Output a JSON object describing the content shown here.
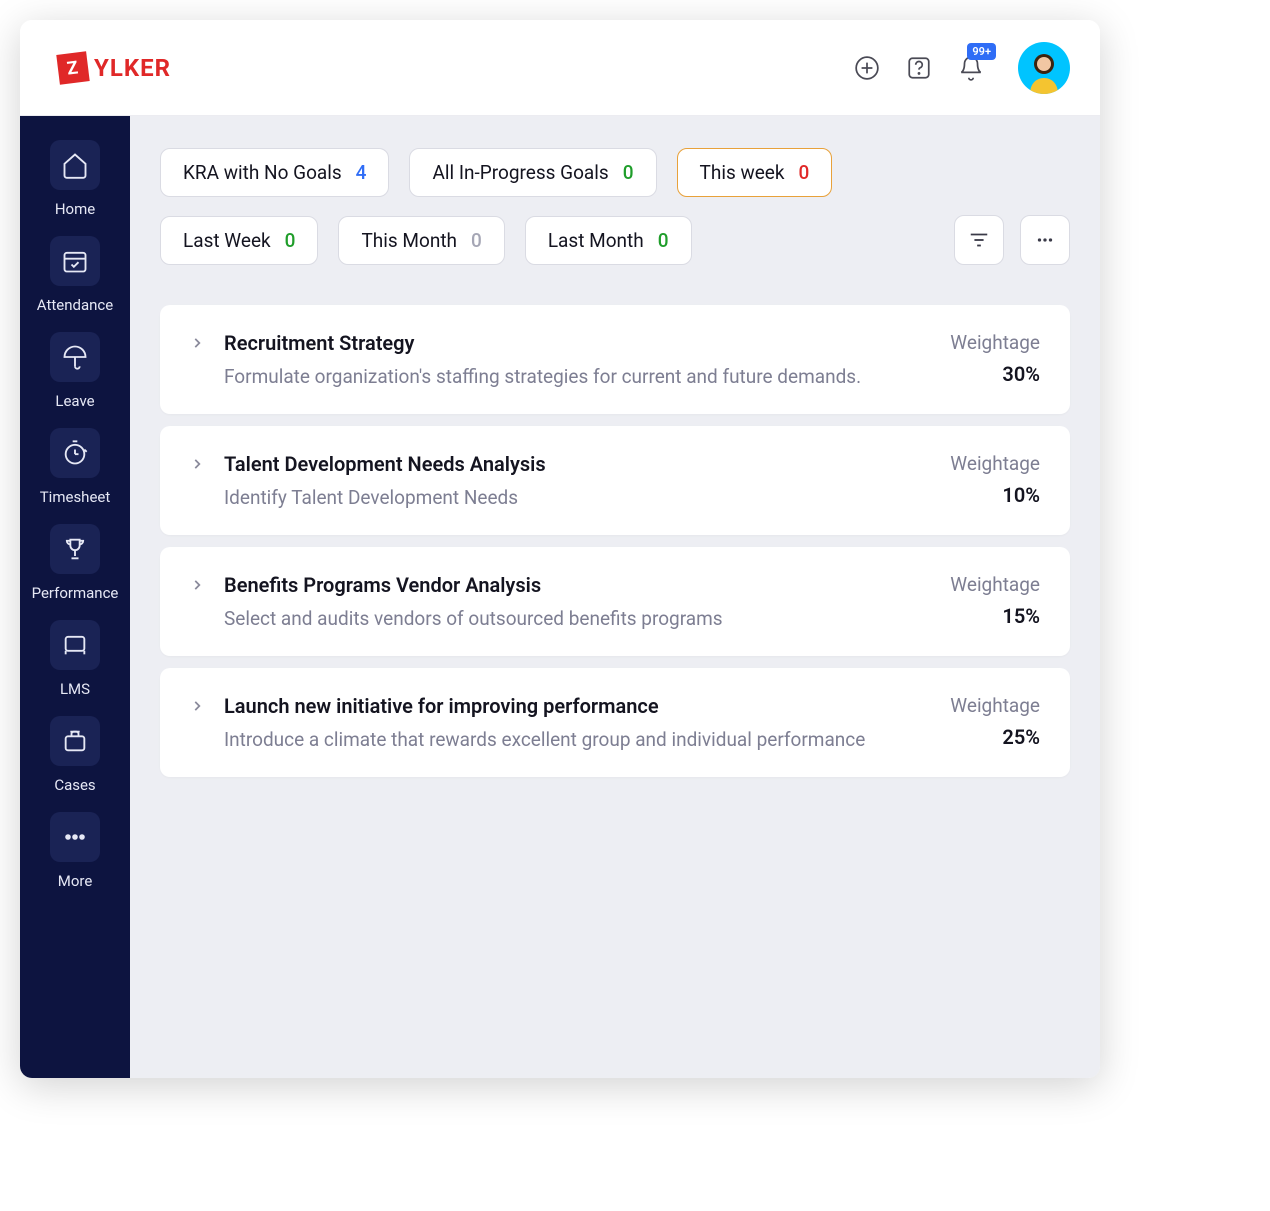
{
  "brand": {
    "mark": "Z",
    "text": "YLKER"
  },
  "topbar": {
    "notification_badge": "99+"
  },
  "sidebar": {
    "items": [
      {
        "label": "Home"
      },
      {
        "label": "Attendance"
      },
      {
        "label": "Leave"
      },
      {
        "label": "Timesheet"
      },
      {
        "label": "Performance"
      },
      {
        "label": "LMS"
      },
      {
        "label": "Cases"
      },
      {
        "label": "More"
      }
    ]
  },
  "filters": {
    "row1": [
      {
        "label": "KRA with No Goals",
        "count": "4",
        "color": "blue"
      },
      {
        "label": "All In-Progress Goals",
        "count": "0",
        "color": "green"
      },
      {
        "label": "This week",
        "count": "0",
        "color": "red",
        "active": true
      }
    ],
    "row2": [
      {
        "label": "Last Week",
        "count": "0",
        "color": "green"
      },
      {
        "label": "This Month",
        "count": "0",
        "color": "zero"
      },
      {
        "label": "Last Month",
        "count": "0",
        "color": "green"
      }
    ]
  },
  "weightage_label": "Weightage",
  "kras": [
    {
      "title": "Recruitment Strategy",
      "desc": "Formulate organization's staffing strategies for current and future demands.",
      "pct": "30%"
    },
    {
      "title": "Talent Development Needs Analysis",
      "desc": "Identify Talent Development Needs",
      "pct": "10%"
    },
    {
      "title": "Benefits Programs Vendor Analysis",
      "desc": "Select and audits vendors of outsourced benefits programs",
      "pct": "15%"
    },
    {
      "title": "Launch new initiative for improving performance",
      "desc": "Introduce a climate that rewards excellent group and individual performance",
      "pct": "25%"
    }
  ]
}
